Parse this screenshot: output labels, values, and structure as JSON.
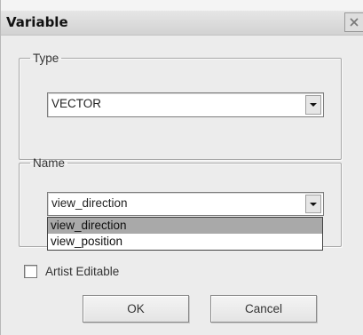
{
  "window": {
    "title": "Variable"
  },
  "type_group": {
    "legend": "Type",
    "selected": "VECTOR"
  },
  "name_group": {
    "legend": "Name",
    "selected": "view_direction",
    "options": [
      "view_direction",
      "view_position"
    ],
    "highlighted_index": 0
  },
  "artist_editable": {
    "label": "Artist Editable",
    "checked": false
  },
  "buttons": {
    "ok": "OK",
    "cancel": "Cancel"
  },
  "icons": {
    "close": "close-icon",
    "dropdown": "chevron-down-icon"
  }
}
